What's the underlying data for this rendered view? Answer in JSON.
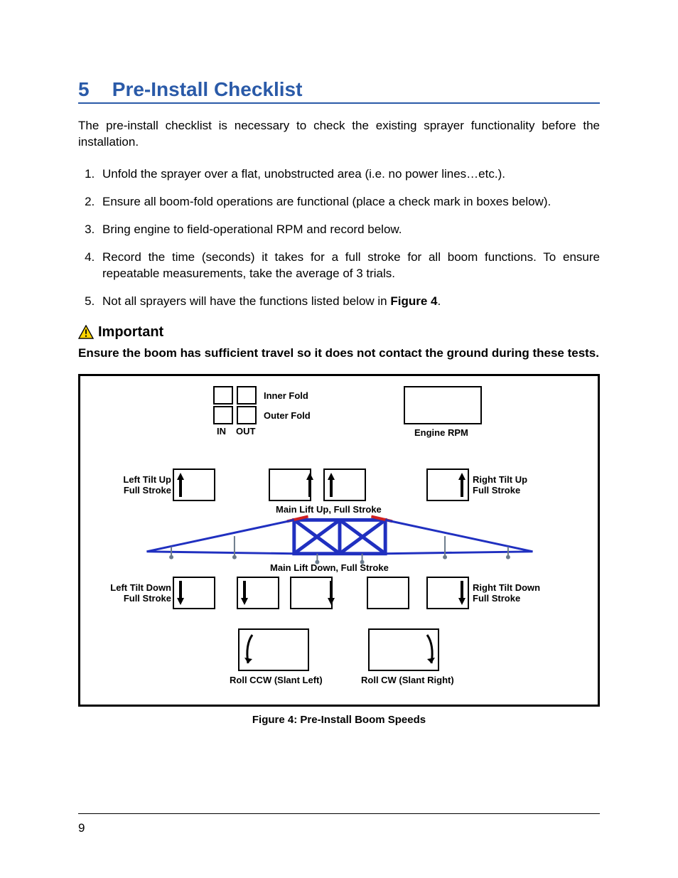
{
  "section": {
    "number": "5",
    "title": "Pre-Install Checklist"
  },
  "intro": "The pre-install checklist is necessary to check the existing sprayer functionality before the installation.",
  "items": [
    "Unfold the sprayer over a flat, unobstructed area (i.e. no power lines…etc.).",
    "Ensure all boom-fold operations are functional (place a check mark in boxes below).",
    "Bring engine to field-operational RPM and record below.",
    "Record the time (seconds) it takes for a full stroke for all boom functions.  To ensure repeatable measurements, take the average of 3 trials.",
    "Not all sprayers will have the functions listed below in "
  ],
  "item5_figref": "Figure 4",
  "item5_tail": ".",
  "important": {
    "label": "Important",
    "text": "Ensure the boom has sufficient travel so it does not contact the ground during these tests."
  },
  "fig": {
    "inner_fold": "Inner Fold",
    "outer_fold": "Outer Fold",
    "in": "IN",
    "out": "OUT",
    "engine_rpm": "Engine RPM",
    "left_tilt_up": "Left Tilt Up\nFull Stroke",
    "right_tilt_up": "Right Tilt Up\nFull Stroke",
    "main_up": "Main Lift Up, Full Stroke",
    "main_down": "Main Lift Down, Full Stroke",
    "left_tilt_down": "Left Tilt Down\nFull Stroke",
    "right_tilt_down": "Right Tilt Down\nFull Stroke",
    "roll_ccw": "Roll CCW (Slant Left)",
    "roll_cw": "Roll CW (Slant Right)",
    "caption": "Figure 4: Pre-Install Boom Speeds"
  },
  "page_number": "9"
}
